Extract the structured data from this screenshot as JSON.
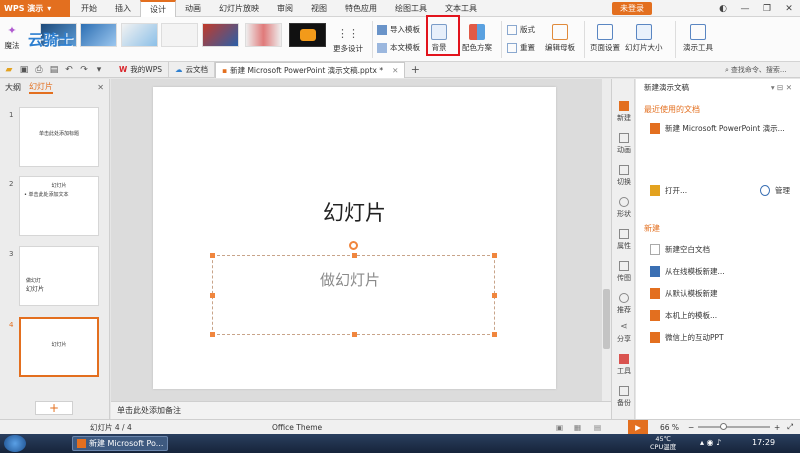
{
  "app": {
    "name": "WPS 演示",
    "login": "未登录"
  },
  "ribbon_tabs": [
    {
      "label": "开始"
    },
    {
      "label": "插入"
    },
    {
      "label": "设计",
      "active": true
    },
    {
      "label": "动画"
    },
    {
      "label": "幻灯片放映"
    },
    {
      "label": "审阅"
    },
    {
      "label": "视图"
    },
    {
      "label": "特色应用"
    },
    {
      "label": "绘图工具"
    },
    {
      "label": "文本工具"
    }
  ],
  "ribbon": {
    "magic": "魔法",
    "watermark": "云骑士",
    "more_design": "更多设计",
    "import_template": "导入模板",
    "this_template": "本文模板",
    "background": "背景",
    "color_scheme": "配色方案",
    "layout": "版式",
    "reset": "重置",
    "edit_master": "编辑母板",
    "page_setup": "页面设置",
    "slide_size": "幻灯片大小",
    "presentation_tools": "演示工具"
  },
  "doc_tabs": [
    {
      "label": "我的WPS"
    },
    {
      "label": "云文档"
    },
    {
      "label": "新建 Microsoft PowerPoint 演示文稿.pptx *",
      "active": true
    }
  ],
  "search": {
    "placeholder": "查找命令、搜索..."
  },
  "left_pane": {
    "tabs": [
      "大纲",
      "幻灯片"
    ],
    "slides": [
      {
        "num": "1",
        "text": "单击此处添加标题"
      },
      {
        "num": "2",
        "text": "幻灯片",
        "sub": "• 单击此处添加文本"
      },
      {
        "num": "3",
        "text": "幻灯片",
        "sub": "做幻灯"
      },
      {
        "num": "4",
        "text": "幻灯片"
      }
    ],
    "add_label": "+"
  },
  "slide": {
    "title": "幻灯片",
    "subtitle": "做幻灯片"
  },
  "notes": "单击此处添加备注",
  "side_tabs": [
    "新建",
    "动画",
    "切换",
    "形状",
    "属性",
    "传图",
    "推荐",
    "分享",
    "工具",
    "备份"
  ],
  "task_pane": {
    "header": "新建演示文稿",
    "recent_title": "最近使用的文档",
    "recent_doc": "新建 Microsoft PowerPoint 演示...",
    "open": "打开...",
    "manage": "管理",
    "new_title": "新建",
    "new_items": [
      "新建空白文档",
      "从在线模板新建...",
      "从默认模板新建",
      "本机上的模板...",
      "微信上的互动PPT"
    ]
  },
  "status": {
    "slide": "幻灯片 4 / 4",
    "theme": "Office Theme",
    "zoom": "66 %"
  },
  "taskbar": {
    "app": "新建 Microsoft Po...",
    "temp": "45℃",
    "cpu": "CPU温度",
    "time": "17:29"
  },
  "colors": {
    "accent": "#e36f1f",
    "highlight": "#e2141d"
  }
}
